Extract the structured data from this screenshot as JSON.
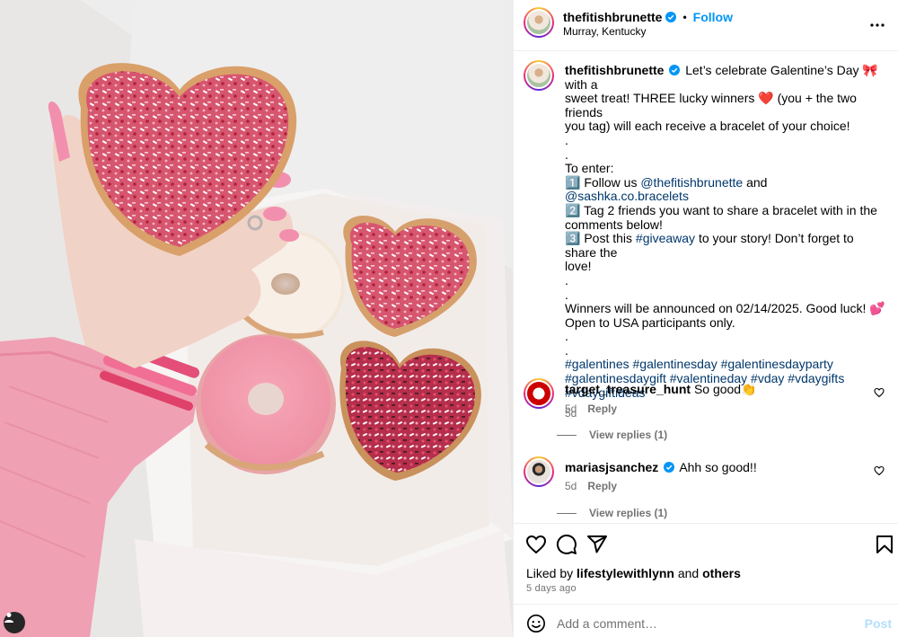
{
  "post": {
    "author": "thefitishbrunette",
    "location": "Murray, Kentucky",
    "follow_label": "Follow",
    "separator": "•"
  },
  "caption": {
    "username": "thefitishbrunette",
    "lines": [
      "Let’s celebrate Galentine’s Day 🎀 with a",
      "sweet treat! THREE lucky winners ❤️ (you + the two friends",
      "you tag) will each receive a bracelet of your choice!",
      ".",
      ".",
      "To enter:"
    ],
    "step1_prefix": "1️⃣ Follow us ",
    "step1_link1": "@thefitishbrunette",
    "step1_mid": " and ",
    "step1_link2": "@sashka.co.bracelets",
    "step2_a": "2️⃣ Tag 2 friends you want to share a bracelet with in the",
    "step2_b": "comments below!",
    "step3_prefix": "3️⃣ Post this ",
    "step3_link": "#giveaway",
    "step3_suffix": " to your story! Don’t forget to share the",
    "step3_b": "love!",
    "dots2": [
      ".",
      "."
    ],
    "winners": "Winners will be announced on 02/14/2025. Good luck! 💕",
    "open_to": "Open to USA participants only.",
    "dots3": [
      ".",
      "."
    ],
    "hashtags": [
      "#galentines #galentinesday #galentinesdayparty",
      "#galentinesdaygift #valentineday #vday #vdaygifts",
      "#vdaygiftideas"
    ],
    "time": "5d"
  },
  "comments": [
    {
      "username": "target_treasure_hunt",
      "text": "So good👏",
      "time": "5d",
      "reply_label": "Reply",
      "view_replies": "View replies (1)",
      "verified": false
    },
    {
      "username": "mariasjsanchez",
      "text": "Ahh so good!!",
      "time": "5d",
      "reply_label": "Reply",
      "view_replies": "View replies (1)",
      "verified": true
    }
  ],
  "likes": {
    "prefix": "Liked by ",
    "user": "lifestylewithlynn",
    "mid": " and ",
    "others": "others"
  },
  "date_label": "5 days ago",
  "comment_box": {
    "placeholder": "Add a comment…",
    "post_label": "Post"
  },
  "colors": {
    "link": "#00376b",
    "follow": "#0095f6",
    "muted": "#737373",
    "post_disabled": "#b2dffc",
    "verified": "#0095f6"
  },
  "icons": [
    "heart-icon",
    "comment-icon",
    "share-icon",
    "bookmark-icon",
    "more-options-icon",
    "emoji-icon",
    "user-tag-icon",
    "verified-badge-icon"
  ]
}
